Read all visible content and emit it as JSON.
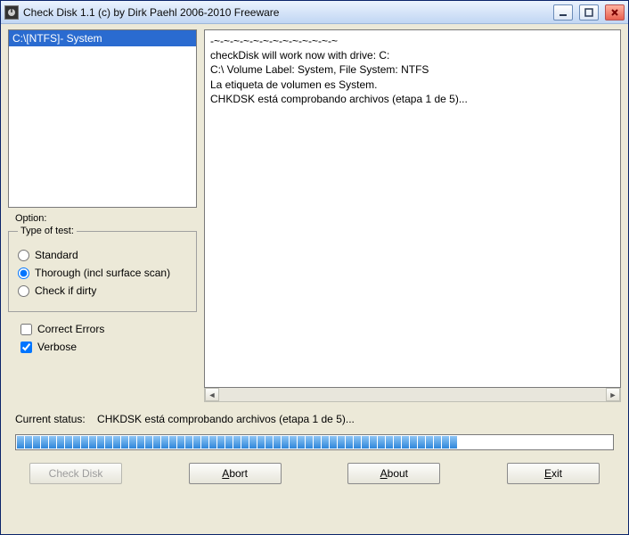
{
  "window": {
    "title": "Check Disk 1.1  (c) by Dirk Paehl  2006-2010 Freeware"
  },
  "drives": {
    "items": [
      "C:\\[NTFS]- System"
    ],
    "selected_index": 0
  },
  "options": {
    "label": "Option:",
    "group_legend": "Type of test:",
    "radio_standard": "Standard",
    "radio_thorough": "Thorough (incl surface scan)",
    "radio_dirty": "Check if dirty",
    "selected_radio": "thorough",
    "check_correct": "Correct Errors",
    "check_verbose": "Verbose",
    "correct_checked": false,
    "verbose_checked": true
  },
  "output": {
    "lines": [
      "-~-~-~-~-~-~-~-~-~-~-~-~-~",
      "checkDisk will work now with drive: C:",
      "C:\\ Volume Label: System, File System: NTFS",
      "La etiqueta de volumen es System.",
      "CHKDSK está comprobando archivos (etapa 1 de 5)..."
    ]
  },
  "status": {
    "label": "Current status:",
    "text": "CHKDSK está comprobando archivos (etapa 1 de 5)..."
  },
  "progress": {
    "filled": 55,
    "total": 70
  },
  "buttons": {
    "check_disk": "Check Disk",
    "check_disk_enabled": false,
    "abort": "Abort",
    "about": "About",
    "exit": "Exit"
  }
}
